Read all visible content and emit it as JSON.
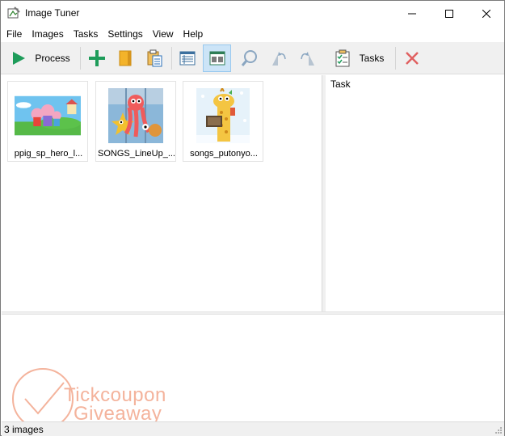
{
  "window": {
    "title": "Image Tuner"
  },
  "menu": [
    {
      "label": "File"
    },
    {
      "label": "Images"
    },
    {
      "label": "Tasks"
    },
    {
      "label": "Settings"
    },
    {
      "label": "View"
    },
    {
      "label": "Help"
    }
  ],
  "toolbar": {
    "process_label": "Process",
    "tasks_label": "Tasks",
    "buttons": [
      {
        "icon": "play-icon",
        "label": "Process"
      },
      {
        "icon": "add-icon"
      },
      {
        "icon": "folder-icon"
      },
      {
        "icon": "paste-icon"
      },
      {
        "icon": "details-view-icon"
      },
      {
        "icon": "thumbnails-view-icon",
        "active": true
      },
      {
        "icon": "zoom-icon"
      },
      {
        "icon": "rotate-left-icon"
      },
      {
        "icon": "rotate-right-icon"
      },
      {
        "icon": "tasks-icon",
        "label": "Tasks"
      },
      {
        "icon": "delete-icon"
      }
    ]
  },
  "images": [
    {
      "label": "ppig_sp_hero_l...",
      "thumb": "pig-family-thumbnail"
    },
    {
      "label": "SONGS_LineUp_...",
      "thumb": "songs-lineup-thumbnail"
    },
    {
      "label": "songs_putonyo...",
      "thumb": "giraffe-thumbnail"
    }
  ],
  "task_pane": {
    "header": "Task"
  },
  "watermark": {
    "line1": "Tickcoupon",
    "line2": "Giveaway",
    "color": "#f4b39c"
  },
  "status": {
    "text": "3 images"
  },
  "colors": {
    "accent_green": "#1e9c5a",
    "delete_red": "#e06060",
    "active_toolbar_bg": "#cce4f7"
  }
}
